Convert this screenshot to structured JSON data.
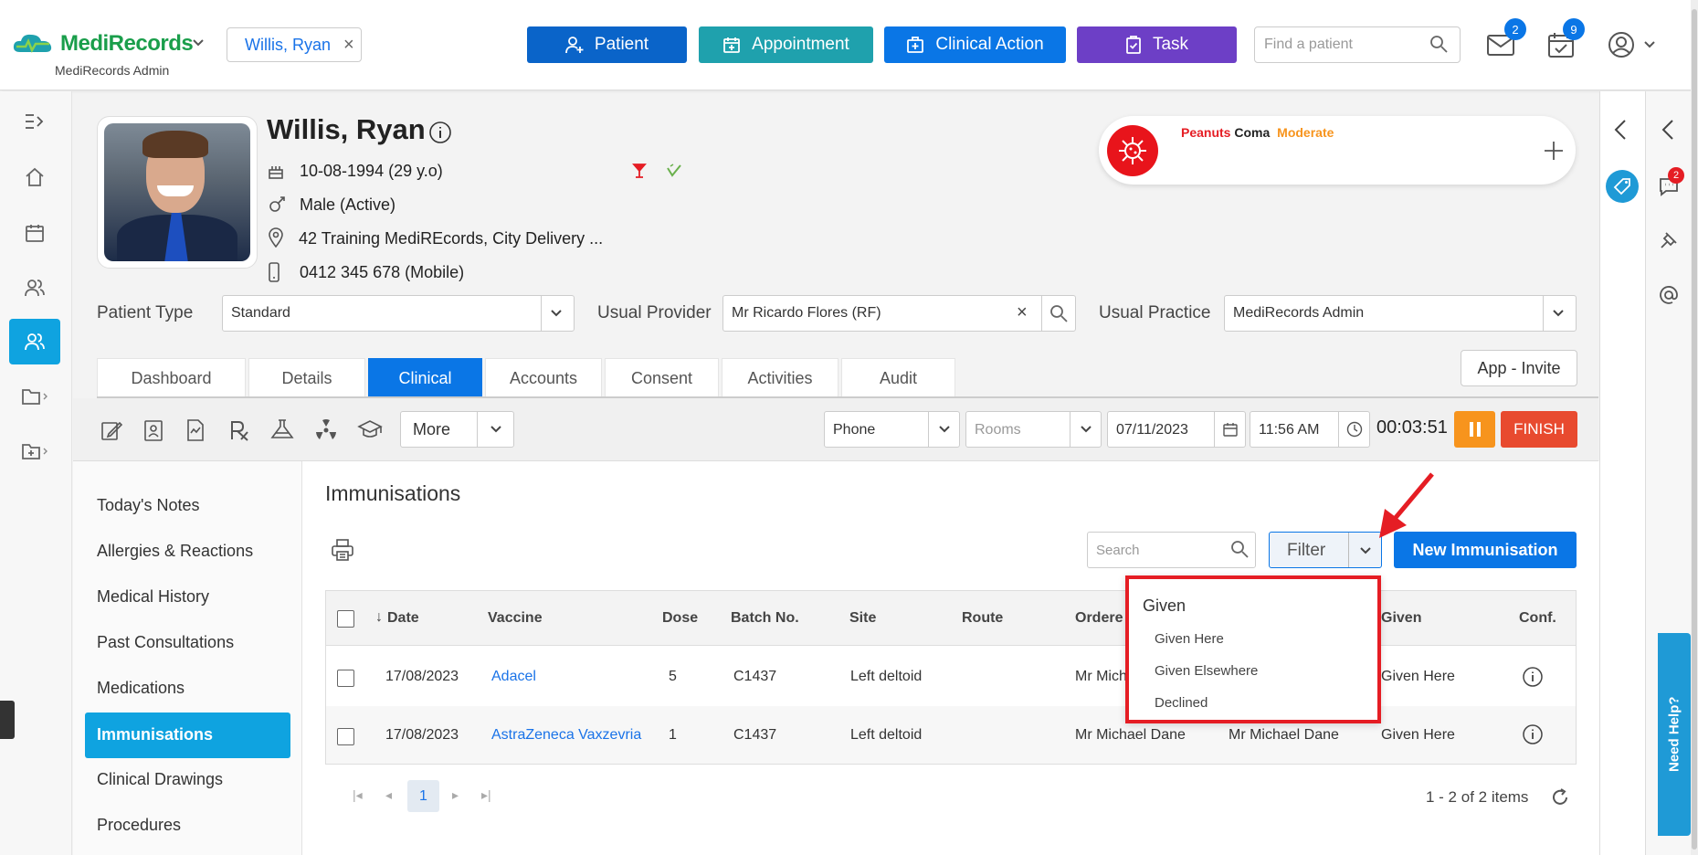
{
  "header": {
    "brand": "MediRecords",
    "brand_sub": "MediRecords Admin",
    "patient_chip": "Willis, Ryan",
    "buttons": {
      "patient": "Patient",
      "appointment": "Appointment",
      "clinical_action": "Clinical Action",
      "task": "Task"
    },
    "search_placeholder": "Find a patient",
    "mail_count": "2",
    "calendar_count": "9"
  },
  "patient": {
    "name": "Willis, Ryan",
    "dob": "10-08-1994 (29 y.o)",
    "gender": "Male (Active)",
    "address": "42 Training MediREcords, City Delivery ...",
    "phone": "0412 345 678 (Mobile)"
  },
  "alert": {
    "allergen": "Peanuts",
    "reaction": "Coma",
    "severity": "Moderate"
  },
  "fields": {
    "patient_type_label": "Patient Type",
    "patient_type_value": "Standard",
    "usual_provider_label": "Usual Provider",
    "usual_provider_value": "Mr Ricardo Flores (RF)",
    "usual_practice_label": "Usual Practice",
    "usual_practice_value": "MediRecords Admin"
  },
  "tabs": [
    {
      "label": "Dashboard"
    },
    {
      "label": "Details"
    },
    {
      "label": "Clinical"
    },
    {
      "label": "Accounts"
    },
    {
      "label": "Consent"
    },
    {
      "label": "Activities"
    },
    {
      "label": "Audit"
    }
  ],
  "app_invite": "App - Invite",
  "toolbar": {
    "more": "More",
    "contact_type": "Phone",
    "rooms_placeholder": "Rooms",
    "date": "07/11/2023",
    "time": "11:56 AM",
    "timer": "00:03:51",
    "finish": "FINISH"
  },
  "clinical_menu": [
    {
      "label": "Today's Notes"
    },
    {
      "label": "Allergies & Reactions"
    },
    {
      "label": "Medical History"
    },
    {
      "label": "Past Consultations"
    },
    {
      "label": "Medications"
    },
    {
      "label": "Immunisations"
    },
    {
      "label": "Clinical Drawings"
    },
    {
      "label": "Procedures"
    }
  ],
  "content": {
    "title": "Immunisations",
    "search_placeholder": "Search",
    "filter": "Filter",
    "new_button": "New Immunisation"
  },
  "table": {
    "headers": [
      "Date",
      "Vaccine",
      "Dose",
      "Batch No.",
      "Site",
      "Route",
      "Ordere",
      "Given",
      "Conf."
    ],
    "rows": [
      {
        "date": "17/08/2023",
        "vaccine": "Adacel",
        "dose": "5",
        "batch": "C1437",
        "site": "Left deltoid",
        "ordered": "Mr Mich",
        "given_by": "",
        "given": "Given Here"
      },
      {
        "date": "17/08/2023",
        "vaccine": "AstraZeneca Vaxzevria",
        "dose": "1",
        "batch": "C1437",
        "site": "Left deltoid",
        "ordered": "Mr Michael Dane",
        "given_by": "Mr Michael Dane",
        "given": "Given Here"
      }
    ]
  },
  "pagination": {
    "current": "1",
    "summary": "1 - 2 of 2 items"
  },
  "filter_dropdown": {
    "heading": "Given",
    "options": [
      "Given Here",
      "Given Elsewhere",
      "Declined"
    ]
  },
  "help": "Need Help?",
  "chat_badge": "2",
  "colors": {
    "primary": "#0a76e6",
    "accent": "#0fa3e0",
    "appointment": "#1fa1ad",
    "task": "#6d3fc6",
    "danger": "#e51d24"
  }
}
